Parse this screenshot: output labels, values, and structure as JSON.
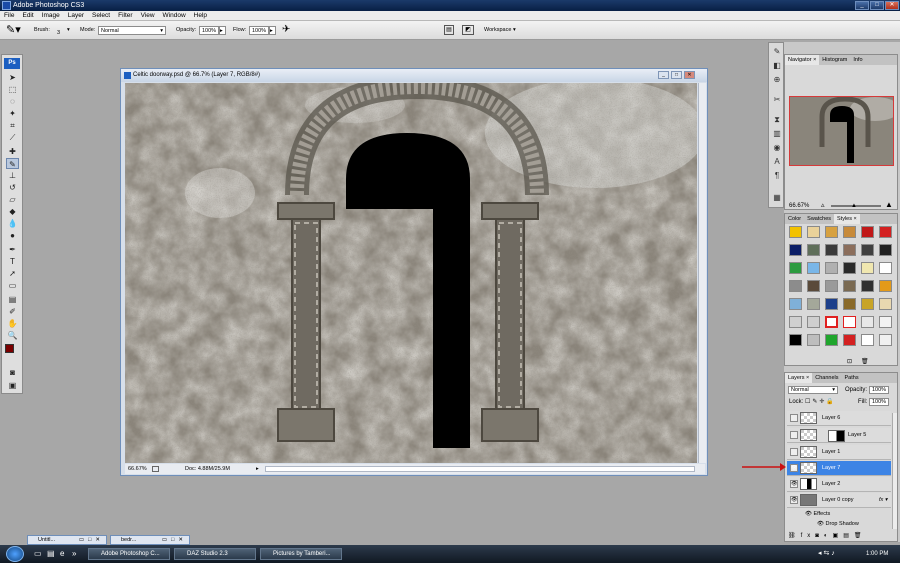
{
  "app": {
    "title": "Adobe Photoshop CS3"
  },
  "menu": [
    "File",
    "Edit",
    "Image",
    "Layer",
    "Select",
    "Filter",
    "View",
    "Window",
    "Help"
  ],
  "options": {
    "brush_label": "Brush:",
    "brush_size": "3",
    "mode_label": "Mode:",
    "mode_value": "Normal",
    "opacity_label": "Opacity:",
    "opacity_value": "100%",
    "flow_label": "Flow:",
    "flow_value": "100%",
    "workspace": "Workspace"
  },
  "toolbox": {
    "logo": "Ps"
  },
  "document": {
    "title": "Celtic doorway.psd @ 66.7% (Layer 7, RGB/8#)",
    "zoom": "66.67%",
    "doc_info": "Doc: 4.88M/25.9M"
  },
  "navigator": {
    "tabs": [
      "Navigator",
      "Histogram",
      "Info"
    ],
    "zoom": "66.67%"
  },
  "color_panel": {
    "tabs": [
      "Color",
      "Swatches",
      "Styles"
    ]
  },
  "layers_panel": {
    "tabs": [
      "Layers",
      "Channels",
      "Paths"
    ],
    "blend_mode": "Normal",
    "opacity_label": "Opacity:",
    "opacity_value": "100%",
    "lock_label": "Lock:",
    "fill_label": "Fill:",
    "fill_value": "100%",
    "layers": [
      {
        "name": "Layer 6"
      },
      {
        "name": "Layer 5"
      },
      {
        "name": "Layer 1"
      },
      {
        "name": "Layer 7"
      },
      {
        "name": "Layer 2"
      },
      {
        "name": "Layer 0 copy"
      },
      {
        "name": "Effects"
      },
      {
        "name": "Drop Shadow"
      }
    ]
  },
  "minimized": [
    "Untitl...",
    "bedr..."
  ],
  "taskbar": {
    "items": [
      "Adobe Photoshop C...",
      "DAZ Studio 2.3",
      "Pictures by Tamberi..."
    ],
    "clock": "1:00 PM"
  }
}
